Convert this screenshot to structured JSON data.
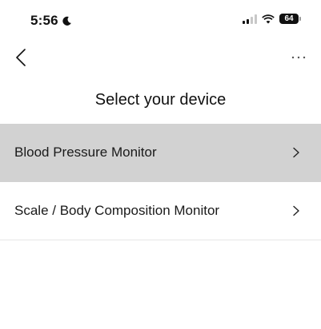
{
  "status_bar": {
    "time": "5:56",
    "battery": "64"
  },
  "nav": {
    "back_icon": "chevron-left-icon",
    "more_icon": "ellipsis-icon"
  },
  "page": {
    "title": "Select your device"
  },
  "devices": [
    {
      "label": "Blood Pressure Monitor",
      "selected": true
    },
    {
      "label": "Scale / Body Composition Monitor",
      "selected": false
    }
  ],
  "colors": {
    "selected_row": "#d2d2d2",
    "divider": "#e6e6e6",
    "text": "#111111"
  }
}
